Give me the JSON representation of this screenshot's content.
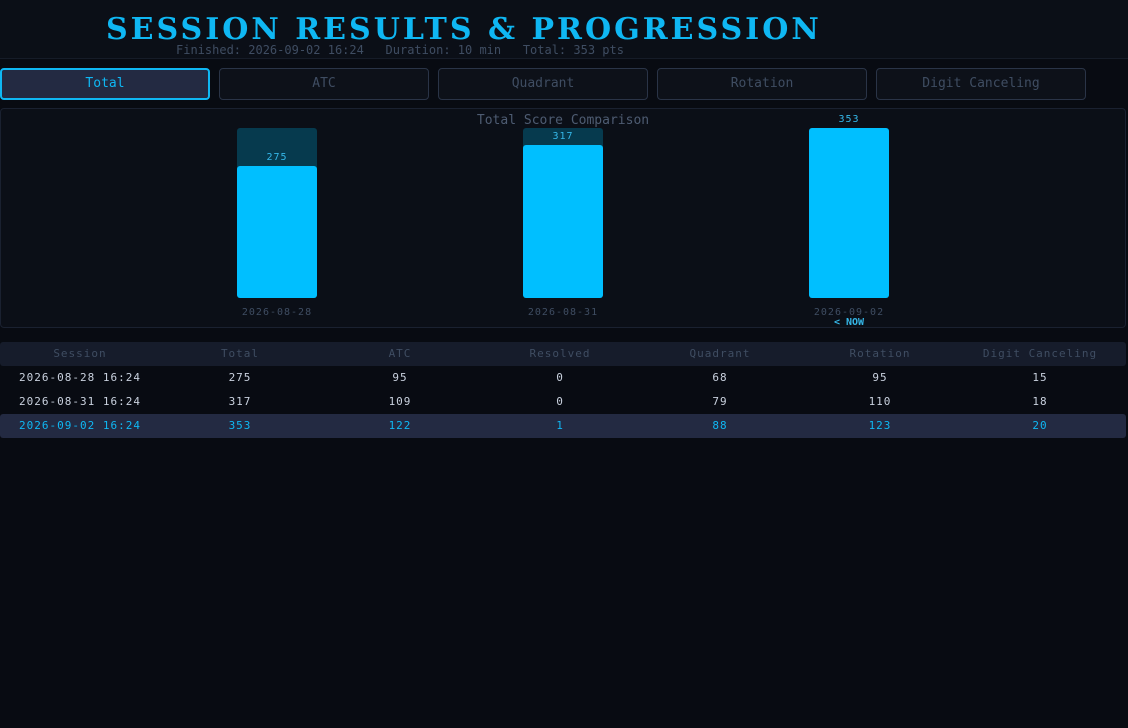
{
  "header": {
    "title": "Session Results & Progression",
    "finished": "Finished: 2026-09-02 16:24",
    "duration": "Duration: 10 min",
    "total": "Total: 353 pts"
  },
  "tabs": [
    {
      "label": "Total",
      "active": true
    },
    {
      "label": "ATC",
      "active": false
    },
    {
      "label": "Quadrant",
      "active": false
    },
    {
      "label": "Rotation",
      "active": false
    },
    {
      "label": "Digit Canceling",
      "active": false
    }
  ],
  "chart_data": {
    "type": "bar",
    "title": "Total Score Comparison",
    "categories": [
      "2026-08-28",
      "2026-08-31",
      "2026-09-02"
    ],
    "values": [
      275,
      317,
      353
    ],
    "max_value": 353,
    "current_marker": "< NOW",
    "current_index": 2,
    "colors": {
      "bar": "#00bfff",
      "background_track": "#063a4e",
      "label": "#35b7e8",
      "category": "#3f4d62"
    }
  },
  "table": {
    "columns": [
      "Session",
      "Total",
      "ATC",
      "Resolved",
      "Quadrant",
      "Rotation",
      "Digit Canceling"
    ],
    "rows": [
      [
        "2026-08-28 16:24",
        "275",
        "95",
        "0",
        "68",
        "95",
        "15"
      ],
      [
        "2026-08-31 16:24",
        "317",
        "109",
        "0",
        "79",
        "110",
        "18"
      ],
      [
        "2026-09-02 16:24",
        "353",
        "122",
        "1",
        "88",
        "123",
        "20"
      ]
    ],
    "current_row": 2
  }
}
